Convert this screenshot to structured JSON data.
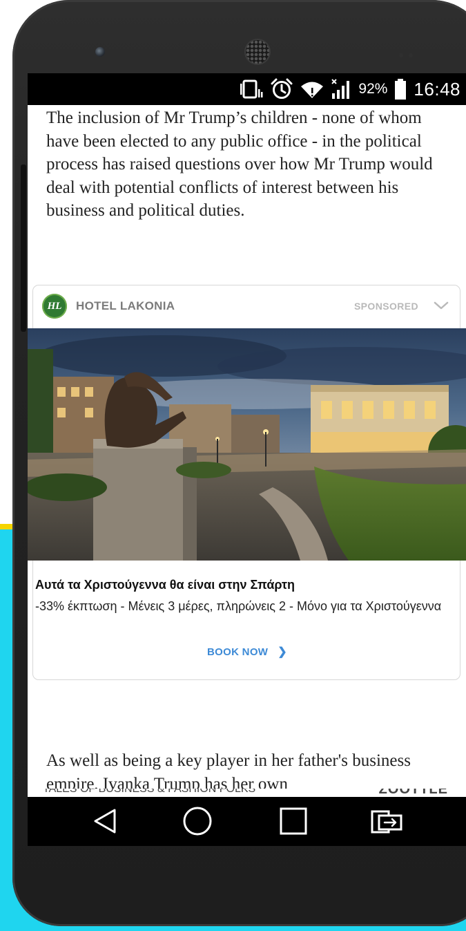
{
  "status_bar": {
    "battery_percent": "92%",
    "time": "16:48",
    "icons": [
      "vibrate-icon",
      "alarm-icon",
      "wifi-icon",
      "signal-icon",
      "battery-icon"
    ]
  },
  "article": {
    "paragraph_1": "The inclusion of Mr Trump’s children - none of whom have been elected to any public office - in the political process has raised questions over how Mr Trump would deal with potential conflicts of interest between his business and political duties.",
    "paragraph_2": "As well as being a key player in her father's business empire, Ivanka Trump has her own"
  },
  "ad": {
    "logo_text": "HL",
    "brand": "HOTEL LAKONIA",
    "sponsored_label": "SPONSORED",
    "title": "Αυτά τα Χριστούγεννα θα είναι στην Σπάρτη",
    "description": "-33% έκπτωση - Μένεις 3 μέρες, πληρώνεις 2  - Μόνο για τα Χριστούγεννα",
    "cta_label": "BOOK NOW",
    "cta_arrow": "❯"
  },
  "watermark": {
    "left": "TALES OF BUSINESS & FASHION FOLKS",
    "right": "ZOOTTLE"
  },
  "nav_bar": {
    "buttons": [
      "back-icon",
      "home-icon",
      "recent-apps-icon",
      "rotate-screen-icon"
    ]
  },
  "colors": {
    "cta_blue": "#3d8ad6",
    "logo_green": "#2f7a32",
    "background_cyan": "#1fd5ef",
    "background_yellow": "#f5d400"
  }
}
